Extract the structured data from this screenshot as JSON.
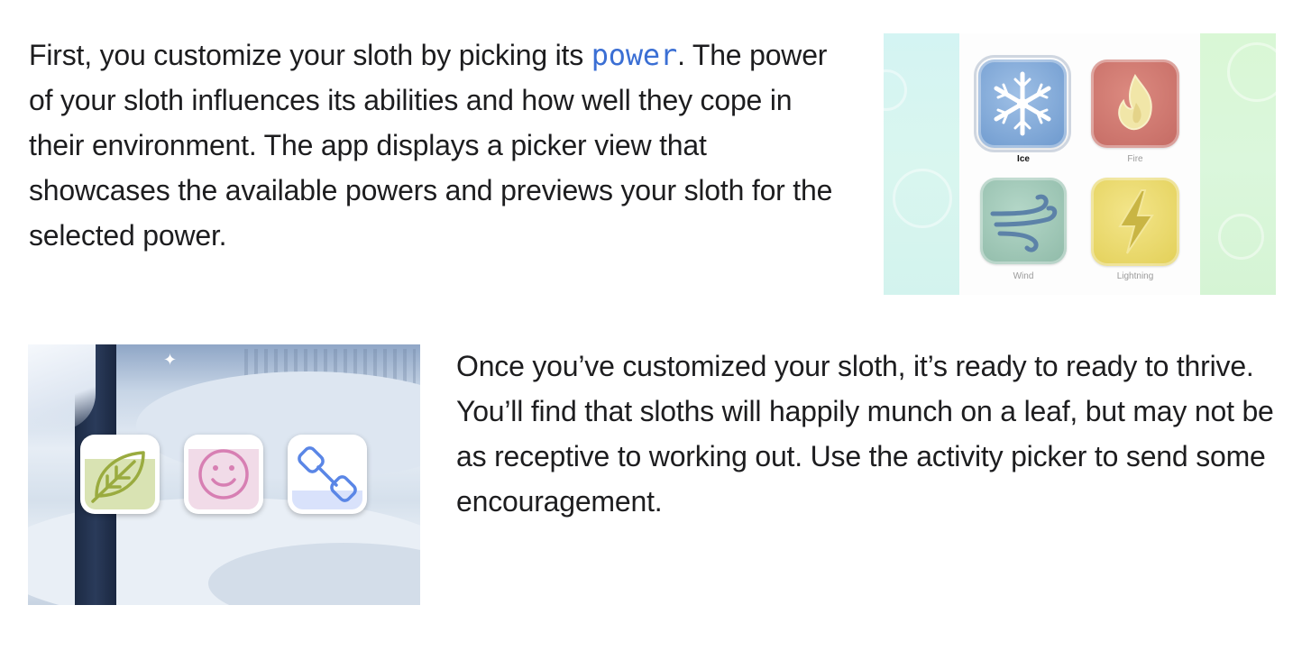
{
  "section_power": {
    "text_before": "First, you customize your sloth by picking its ",
    "code_term": "power",
    "text_after": ". The power of your sloth influences its abilities and how well they cope in their environment. The app displays a picker view that showcases the available powers and previews your sloth for the selected power."
  },
  "power_picker": {
    "selected": "Ice",
    "powers": [
      {
        "label": "Ice",
        "icon": "snowflake-icon",
        "color": "#7aa3d6"
      },
      {
        "label": "Fire",
        "icon": "flame-icon",
        "color": "#cc756c"
      },
      {
        "label": "Wind",
        "icon": "wind-icon",
        "color": "#9fc7b6"
      },
      {
        "label": "Lightning",
        "icon": "lightning-bolt-icon",
        "color": "#ead86a"
      }
    ]
  },
  "section_activity": {
    "text": "Once you’ve customized your sloth, it’s ready to ready to thrive. You’ll find that sloths will happily munch on a leaf, but may not be as receptive to working out. Use the activity picker to send some encouragement."
  },
  "activity_picker": {
    "activities": [
      {
        "icon": "leaf-icon",
        "color": "#9aab3f",
        "level": 0.72
      },
      {
        "icon": "smiley-face-icon",
        "color": "#d77fb3",
        "level": 0.86
      },
      {
        "icon": "dumbbell-icon",
        "color": "#5a86e6",
        "level": 0.27
      }
    ]
  }
}
